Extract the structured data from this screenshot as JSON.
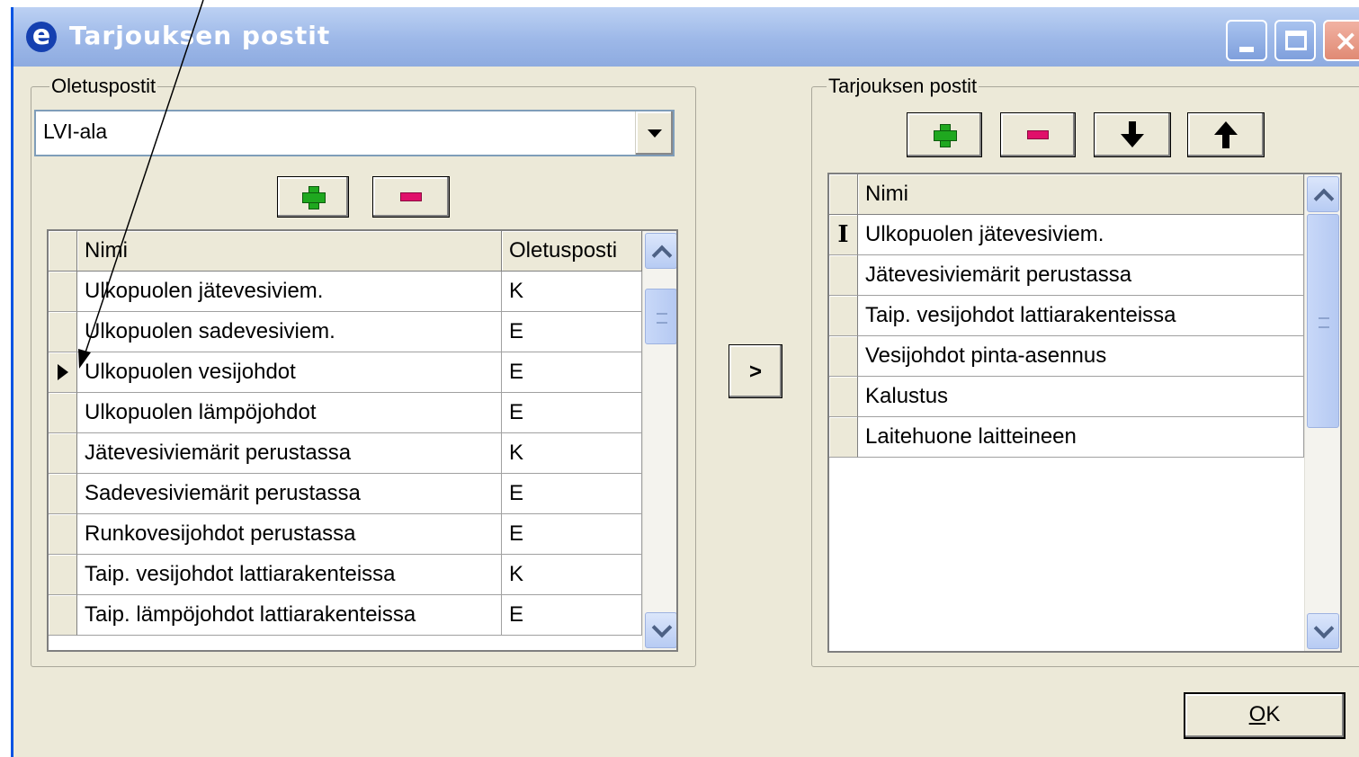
{
  "window": {
    "title": "Tarjouksen postit",
    "app_icon": "e",
    "controls": {
      "minimize": "minimize-icon",
      "maximize": "maximize-icon",
      "close": "close-icon"
    }
  },
  "left_group": {
    "legend": "Oletuspostit",
    "combo_value": "LVI-ala",
    "columns": [
      "Nimi",
      "Oletusposti"
    ],
    "rows": [
      {
        "name": "Ulkopuolen jätevesiviem.",
        "default": "K"
      },
      {
        "name": "Ulkopuolen sadevesiviem.",
        "default": "E"
      },
      {
        "name": "Ulkopuolen vesijohdot",
        "default": "E",
        "current": true
      },
      {
        "name": "Ulkopuolen lämpöjohdot",
        "default": "E"
      },
      {
        "name": "Jätevesiviemärit perustassa",
        "default": "K"
      },
      {
        "name": "Sadevesiviemärit perustassa",
        "default": "E"
      },
      {
        "name": "Runkovesijohdot perustassa",
        "default": "E"
      },
      {
        "name": "Taip. vesijohdot lattiarakenteissa",
        "default": "K"
      },
      {
        "name": "Taip. lämpöjohdot lattiarakenteissa",
        "default": "E"
      }
    ]
  },
  "transfer_button": ">",
  "right_group": {
    "legend": "Tarjouksen postit",
    "columns": [
      "Nimi"
    ],
    "rows": [
      {
        "name": "Ulkopuolen jätevesiviem.",
        "editing": true
      },
      {
        "name": "Jätevesiviemärit perustassa"
      },
      {
        "name": "Taip. vesijohdot lattiarakenteissa"
      },
      {
        "name": "Vesijohdot pinta-asennus"
      },
      {
        "name": "Kalustus"
      },
      {
        "name": "Laitehuone laitteineen"
      }
    ]
  },
  "ok_button": {
    "mnemonic": "O",
    "rest": "K"
  },
  "colors": {
    "titlebar": "#9db8e8",
    "face": "#ece9d8",
    "plus": "#1fa81f",
    "minus": "#e0106a"
  }
}
